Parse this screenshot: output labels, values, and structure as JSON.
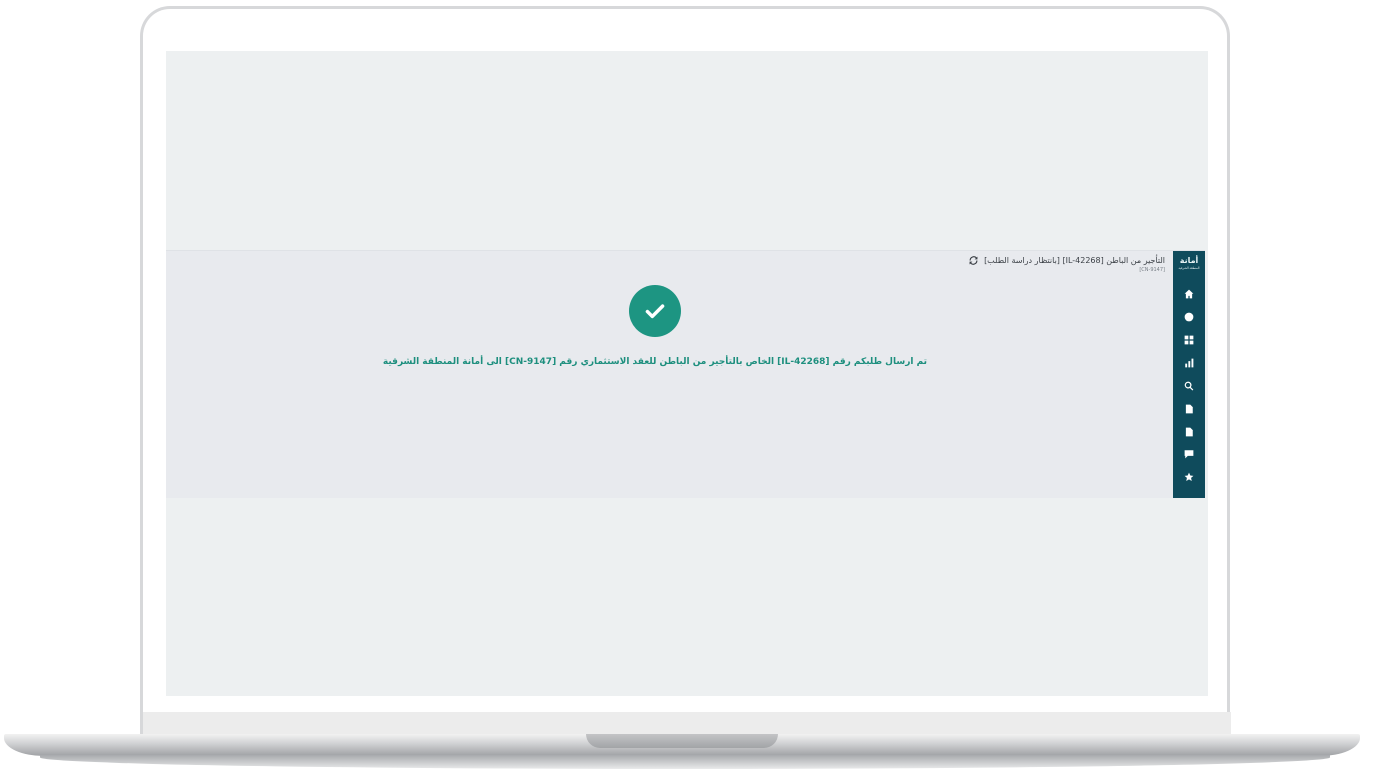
{
  "sidebar": {
    "logo_text": "أمانة",
    "logo_subtext": "المنطقة الشرقية",
    "items": [
      {
        "icon": "home-icon"
      },
      {
        "icon": "circle-icon"
      },
      {
        "icon": "grid-icon"
      },
      {
        "icon": "chart-icon"
      },
      {
        "icon": "search-icon"
      },
      {
        "icon": "document-icon"
      },
      {
        "icon": "file-icon"
      },
      {
        "icon": "chat-icon"
      },
      {
        "icon": "star-icon"
      }
    ]
  },
  "header": {
    "title": "التأجير من الباطن [IL-42268] [بانتظار دراسة الطلب]",
    "subtitle": "[CN-9147]"
  },
  "success": {
    "message": "تم ارسال طلبكم رقم [IL-42268] الخاص بالتأجير من الباطن للعقد الاستثماري رقم [CN-9147] الى أمانة المنطقة الشرقية"
  },
  "colors": {
    "sidebar": "#0f4b5c",
    "success": "#1d9582",
    "message_text": "#1d8f7e",
    "app_background": "#e8eaee",
    "screen_background": "#edf0f1"
  }
}
